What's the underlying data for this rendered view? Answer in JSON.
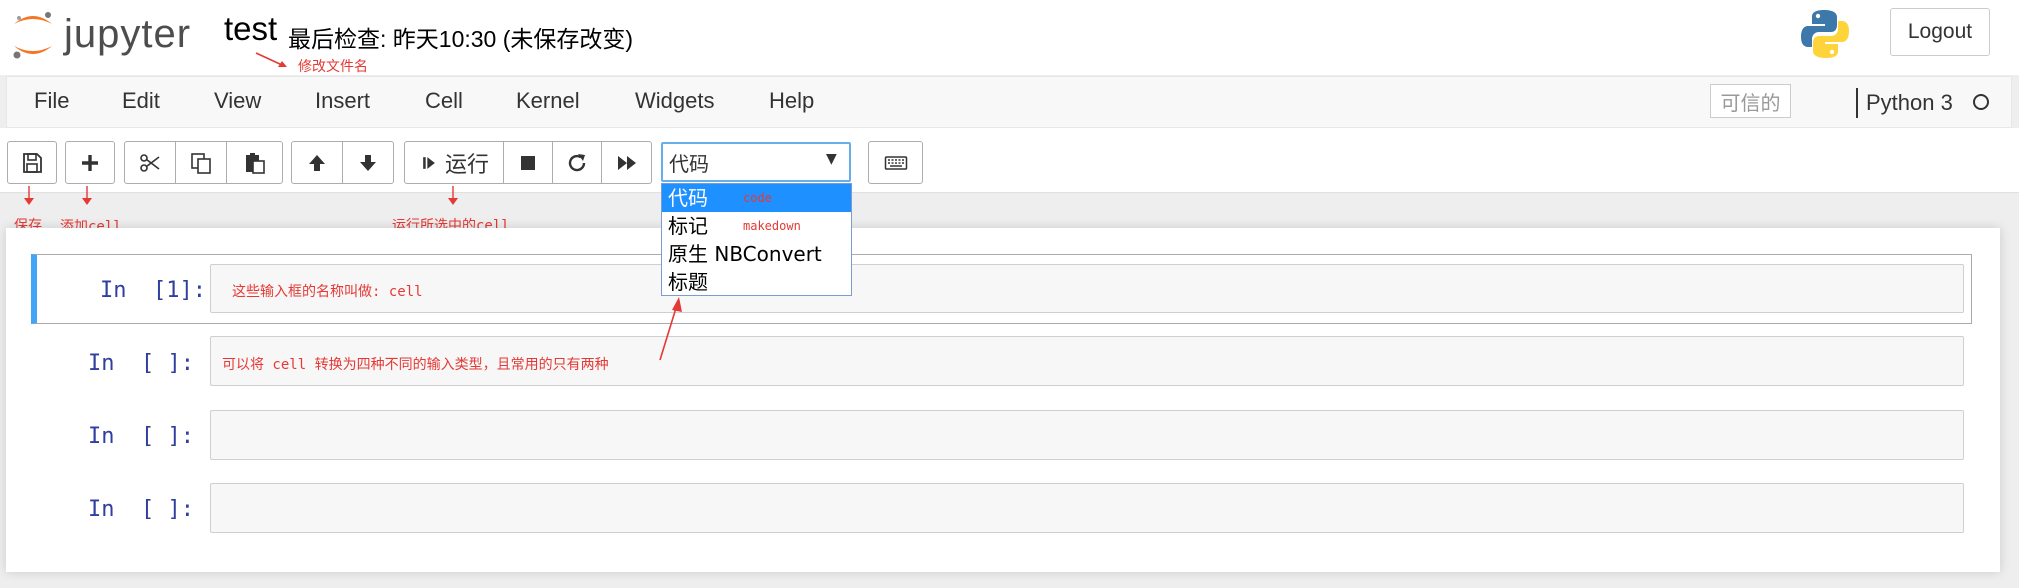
{
  "header": {
    "logo_text": "jupyter",
    "notebook_name": "test",
    "checkpoint": "最后检查: 昨天10:30  (未保存改变)",
    "logout_label": "Logout"
  },
  "menubar": {
    "items": [
      "File",
      "Edit",
      "View",
      "Insert",
      "Cell",
      "Kernel",
      "Widgets",
      "Help"
    ],
    "trusted": "可信的",
    "kernel": "Python 3"
  },
  "toolbar": {
    "run_label": "运行",
    "cell_type_selected": "代码",
    "cell_type_options": [
      "代码",
      "标记",
      "原生 NBConvert",
      "标题"
    ]
  },
  "cells": [
    {
      "prompt": "In  [1]:",
      "content": "这些输入框的名称叫做: cell"
    },
    {
      "prompt": "In  [ ]:",
      "content": "可以将 cell 转换为四种不同的输入类型，且常用的只有两种"
    },
    {
      "prompt": "In  [ ]:",
      "content": ""
    },
    {
      "prompt": "In  [ ]:",
      "content": ""
    }
  ],
  "annotations": {
    "rename": "修改文件名",
    "save": "保存",
    "add_cell": "添加cell",
    "run_cell": "运行所选中的cell",
    "code": "code",
    "markdown": "makedown"
  },
  "colors": {
    "accent": "#42a5f5",
    "annotation": "#e53935",
    "prompt": "#303f9f",
    "dropdown_selected": "#1e90ff"
  }
}
